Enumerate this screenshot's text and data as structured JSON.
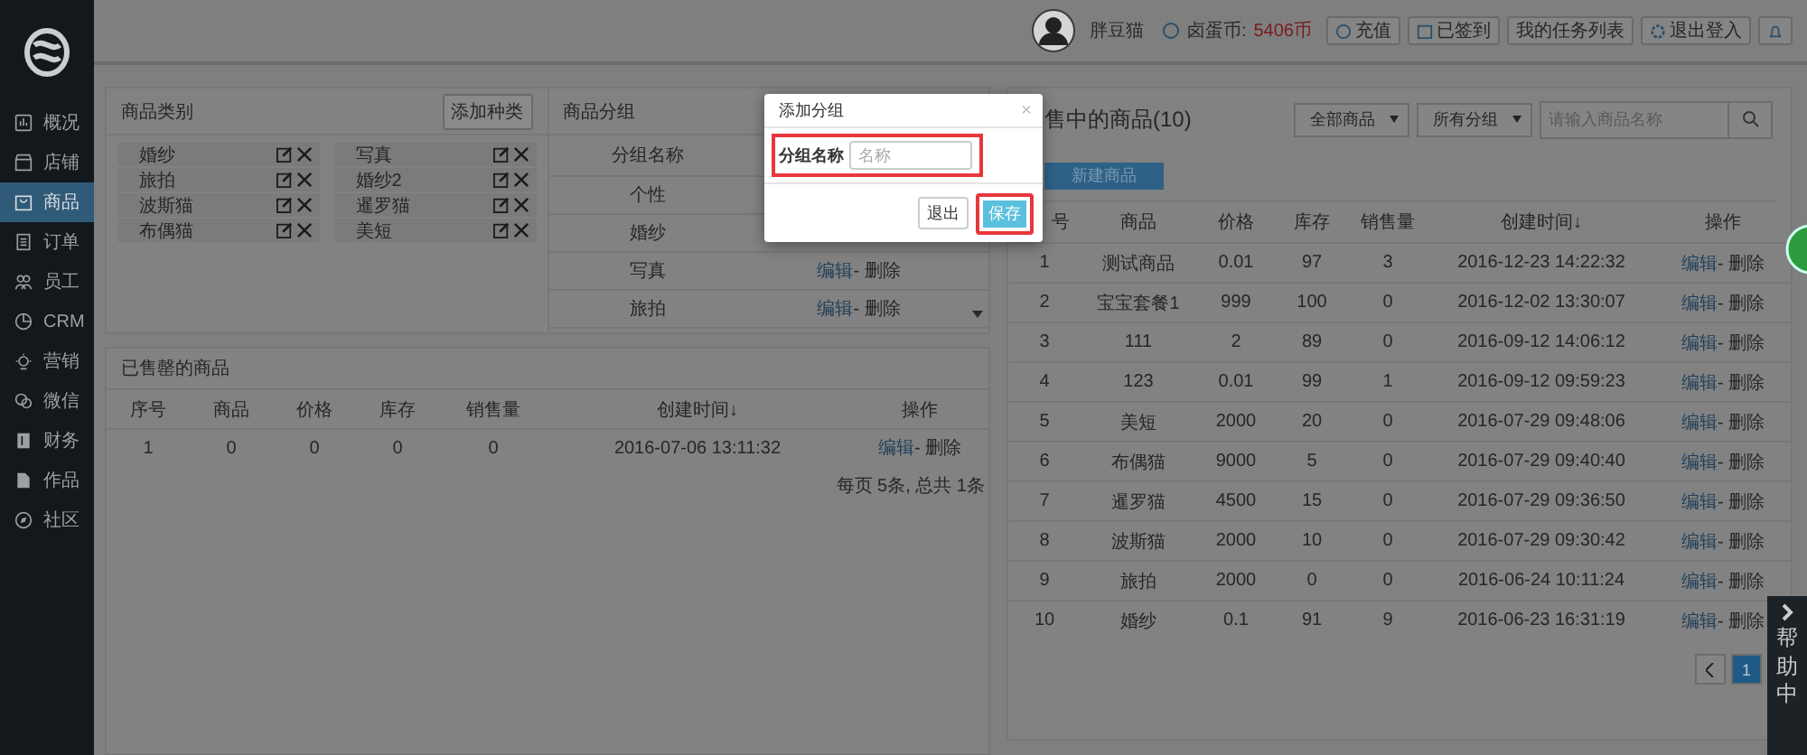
{
  "header": {
    "username": "胖豆猫",
    "coin_label": "卤蛋币:",
    "coin_amount": "5406币",
    "buttons": [
      {
        "kind": "recharge",
        "label": "充值"
      },
      {
        "kind": "signed",
        "label": "已签到"
      },
      {
        "kind": "plain",
        "label": "我的任务列表"
      },
      {
        "kind": "logout",
        "label": "退出登入"
      },
      {
        "kind": "bell"
      }
    ]
  },
  "sidebar": {
    "items": [
      {
        "label": "概况",
        "selected": false
      },
      {
        "label": "店铺",
        "selected": false
      },
      {
        "label": "商品",
        "selected": true
      },
      {
        "label": "订单",
        "selected": false
      },
      {
        "label": "员工",
        "selected": false
      },
      {
        "label": "CRM",
        "selected": false
      },
      {
        "label": "营销",
        "selected": false
      },
      {
        "label": "微信",
        "selected": false
      },
      {
        "label": "财务",
        "selected": false
      },
      {
        "label": "作品",
        "selected": false
      },
      {
        "label": "社区",
        "selected": false
      }
    ]
  },
  "categories": {
    "title": "商品类别",
    "add_button": "添加种类",
    "items": [
      "婚纱",
      "写真",
      "旅拍",
      "婚纱2",
      "波斯猫",
      "暹罗猫",
      "布偶猫",
      "美短"
    ]
  },
  "groups": {
    "title": "商品分组",
    "column": "分组名称",
    "rows": [
      {
        "name": "个性"
      },
      {
        "name": "婚纱"
      },
      {
        "name": "写真",
        "edit": "编辑",
        "delete": "- 删除"
      },
      {
        "name": "旅拍",
        "edit": "编辑",
        "delete": "- 删除"
      }
    ]
  },
  "sold_out": {
    "title": "已售罄的商品",
    "columns": [
      "序号",
      "商品",
      "价格",
      "库存",
      "销售量",
      "创建时间↓",
      "操作"
    ],
    "rows": [
      {
        "cells": [
          "1",
          "0",
          "0",
          "0",
          "0",
          "2016-07-06 13:11:32"
        ],
        "edit": "编辑",
        "delete": "- 删除"
      }
    ],
    "footer": "每页 5条, 总共 1条"
  },
  "on_sale": {
    "title": "售中的商品(10)",
    "filters": [
      "全部商品",
      "所有分组"
    ],
    "search_placeholder": "请输入商品名称",
    "new_button": "新建商品",
    "columns": [
      "号",
      "商品",
      "价格",
      "库存",
      "销售量",
      "创建时间↓",
      "操作"
    ],
    "rows": [
      {
        "cells": [
          "1",
          "测试商品",
          "0.01",
          "97",
          "3",
          "2016-12-23 14:22:32"
        ],
        "edit": "编辑",
        "delete": "- 删除"
      },
      {
        "cells": [
          "2",
          "宝宝套餐1",
          "999",
          "100",
          "0",
          "2016-12-02 13:30:07"
        ],
        "edit": "编辑",
        "delete": "- 删除"
      },
      {
        "cells": [
          "3",
          "111",
          "2",
          "89",
          "0",
          "2016-09-12 14:06:12"
        ],
        "edit": "编辑",
        "delete": "- 删除"
      },
      {
        "cells": [
          "4",
          "123",
          "0.01",
          "99",
          "1",
          "2016-09-12 09:59:23"
        ],
        "edit": "编辑",
        "delete": "- 删除"
      },
      {
        "cells": [
          "5",
          "美短",
          "2000",
          "20",
          "0",
          "2016-07-29 09:48:06"
        ],
        "edit": "编辑",
        "delete": "- 删除"
      },
      {
        "cells": [
          "6",
          "布偶猫",
          "9000",
          "5",
          "0",
          "2016-07-29 09:40:40"
        ],
        "edit": "编辑",
        "delete": "- 删除"
      },
      {
        "cells": [
          "7",
          "暹罗猫",
          "4500",
          "15",
          "0",
          "2016-07-29 09:36:50"
        ],
        "edit": "编辑",
        "delete": "- 删除"
      },
      {
        "cells": [
          "8",
          "波斯猫",
          "2000",
          "10",
          "0",
          "2016-07-29 09:30:42"
        ],
        "edit": "编辑",
        "delete": "- 删除"
      },
      {
        "cells": [
          "9",
          "旅拍",
          "2000",
          "0",
          "0",
          "2016-06-24 10:11:24"
        ],
        "edit": "编辑",
        "delete": "- 删除"
      },
      {
        "cells": [
          "10",
          "婚纱",
          "0.1",
          "91",
          "9",
          "2016-06-23 16:31:19"
        ],
        "edit": "编辑",
        "delete": "- 删除"
      }
    ],
    "pages": [
      {
        "label": "1",
        "selected": true
      }
    ]
  },
  "dialog": {
    "title": "添加分组",
    "close": "×",
    "field_label": "分组名称",
    "field_placeholder": "名称",
    "field_highlighted": true,
    "buttons": [
      {
        "label": "退出",
        "primary": false,
        "highlighted": false
      },
      {
        "label": "保存",
        "primary": true,
        "highlighted": true
      }
    ]
  },
  "help_tab": {
    "label": "帮助中"
  }
}
